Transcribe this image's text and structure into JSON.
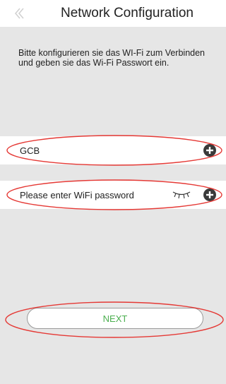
{
  "header": {
    "title": "Network Configuration",
    "back_icon": "chevron-left-icon"
  },
  "instructions": "Bitte konfigurieren sie das WI-Fi zum Verbinden und geben sie das Wi-Fi Passwort ein.",
  "ssid_field": {
    "value": "GCB",
    "clear_icon": "clear-icon"
  },
  "password_field": {
    "placeholder": "Please enter WiFi password",
    "eye_icon": "eye-closed-icon",
    "clear_icon": "clear-icon"
  },
  "next_button": {
    "label": "NEXT"
  },
  "colors": {
    "accent": "#4caf50",
    "annotation": "#e53935",
    "background": "#e6e6e6"
  }
}
